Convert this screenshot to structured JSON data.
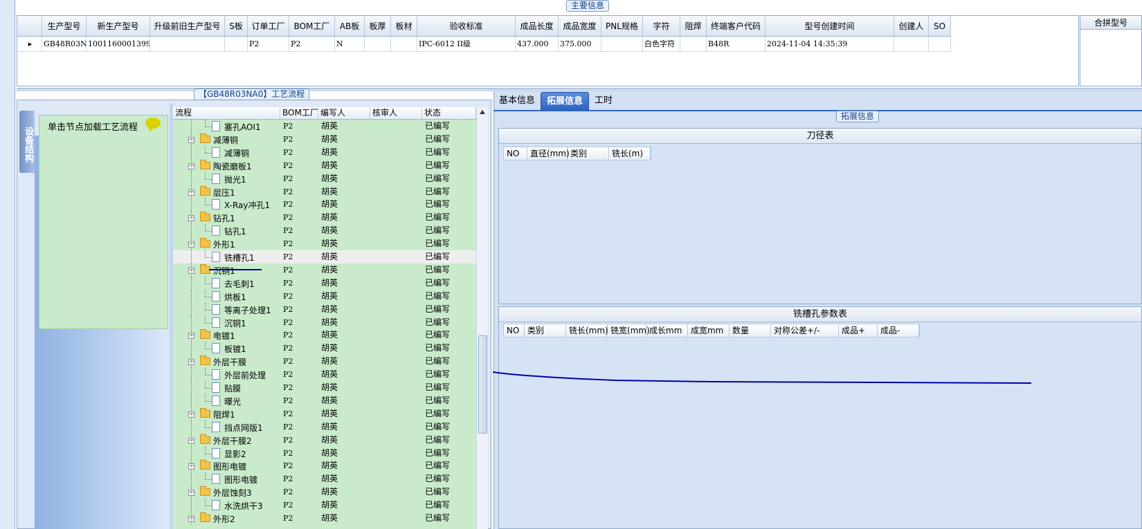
{
  "main_section_title": "主要信息",
  "top_grid": {
    "headers": [
      "生产型号",
      "新生产型号",
      "升级前旧生产型号",
      "S板",
      "订单工厂",
      "BOM工厂",
      "AB板",
      "板厚",
      "板材",
      "验收标准",
      "成品长度",
      "成品宽度",
      "PNL规格",
      "字符",
      "阻焊",
      "终端客户代码",
      "型号创建时间",
      "创建人",
      "SO"
    ],
    "row": [
      "GB48R03NA0",
      "10011600013991",
      "",
      "",
      "P2",
      "P2",
      "N",
      "",
      "",
      "IPC-6012 II级",
      "437.000",
      "375.000",
      "",
      "白色字符",
      "",
      "B48R",
      "2024-11-04 14:35:39",
      "",
      ""
    ],
    "row_marker": "▸"
  },
  "right_grid": {
    "header": "合拼型号"
  },
  "process": {
    "title": "【GB48R03NA0】工艺流程",
    "side_tab": "设备结构",
    "hint": "单击节点加载工艺流程",
    "headers": [
      "流程",
      "BOM工厂",
      "编写人",
      "核审人",
      "状态"
    ],
    "rows": [
      {
        "name": "塞孔AOI1",
        "level": 2,
        "bom": "P2",
        "author": "胡英",
        "status": "已编写"
      },
      {
        "name": "减薄铜",
        "level": 1,
        "bom": "P2",
        "author": "胡英",
        "status": "已编写"
      },
      {
        "name": "减薄铜",
        "level": 2,
        "bom": "P2",
        "author": "胡英",
        "status": "已编写"
      },
      {
        "name": "陶瓷磨板1",
        "level": 1,
        "bom": "P2",
        "author": "胡英",
        "status": "已编写"
      },
      {
        "name": "抛光1",
        "level": 2,
        "bom": "P2",
        "author": "胡英",
        "status": "已编写"
      },
      {
        "name": "层压1",
        "level": 1,
        "bom": "P2",
        "author": "胡英",
        "status": "已编写"
      },
      {
        "name": "X-Ray冲孔1",
        "level": 2,
        "bom": "P2",
        "author": "胡英",
        "status": "已编写"
      },
      {
        "name": "钻孔1",
        "level": 1,
        "bom": "P2",
        "author": "胡英",
        "status": "已编写"
      },
      {
        "name": "钻孔1",
        "level": 2,
        "bom": "P2",
        "author": "胡英",
        "status": "已编写"
      },
      {
        "name": "外形1",
        "level": 1,
        "bom": "P2",
        "author": "胡英",
        "status": "已编写"
      },
      {
        "name": "铣槽孔1",
        "level": 2,
        "bom": "P2",
        "author": "胡英",
        "status": "已编写",
        "selected": true
      },
      {
        "name": "沉铜1",
        "level": 1,
        "bom": "P2",
        "author": "胡英",
        "status": "已编写"
      },
      {
        "name": "去毛刺1",
        "level": 2,
        "bom": "P2",
        "author": "胡英",
        "status": "已编写"
      },
      {
        "name": "烘板1",
        "level": 2,
        "bom": "P2",
        "author": "胡英",
        "status": "已编写"
      },
      {
        "name": "等离子处理1",
        "level": 2,
        "bom": "P2",
        "author": "胡英",
        "status": "已编写"
      },
      {
        "name": "沉铜1",
        "level": 2,
        "bom": "P2",
        "author": "胡英",
        "status": "已编写"
      },
      {
        "name": "电镀1",
        "level": 1,
        "bom": "P2",
        "author": "胡英",
        "status": "已编写"
      },
      {
        "name": "板镀1",
        "level": 2,
        "bom": "P2",
        "author": "胡英",
        "status": "已编写"
      },
      {
        "name": "外层干膜",
        "level": 1,
        "bom": "P2",
        "author": "胡英",
        "status": "已编写"
      },
      {
        "name": "外层前处理",
        "level": 2,
        "bom": "P2",
        "author": "胡英",
        "status": "已编写"
      },
      {
        "name": "贴膜",
        "level": 2,
        "bom": "P2",
        "author": "胡英",
        "status": "已编写"
      },
      {
        "name": "曝光",
        "level": 2,
        "bom": "P2",
        "author": "胡英",
        "status": "已编写"
      },
      {
        "name": "阻焊1",
        "level": 1,
        "bom": "P2",
        "author": "胡英",
        "status": "已编写"
      },
      {
        "name": "挡点网版1",
        "level": 2,
        "bom": "P2",
        "author": "胡英",
        "status": "已编写"
      },
      {
        "name": "外层干膜2",
        "level": 1,
        "bom": "P2",
        "author": "胡英",
        "status": "已编写"
      },
      {
        "name": "显影2",
        "level": 2,
        "bom": "P2",
        "author": "胡英",
        "status": "已编写"
      },
      {
        "name": "图形电镀",
        "level": 1,
        "bom": "P2",
        "author": "胡英",
        "status": "已编写"
      },
      {
        "name": "图形电镀",
        "level": 2,
        "bom": "P2",
        "author": "胡英",
        "status": "已编写"
      },
      {
        "name": "外层蚀刻3",
        "level": 1,
        "bom": "P2",
        "author": "胡英",
        "status": "已编写"
      },
      {
        "name": "水洗烘干3",
        "level": 2,
        "bom": "P2",
        "author": "胡英",
        "status": "已编写"
      },
      {
        "name": "外形2",
        "level": 1,
        "bom": "P2",
        "author": "胡英",
        "status": "已编写"
      }
    ]
  },
  "right": {
    "tabs": [
      "基本信息",
      "拓展信息",
      "工时"
    ],
    "active_tab": 1,
    "section_title": "拓展信息",
    "cutter_table": {
      "title": "刀径表",
      "headers": [
        "NO",
        "直径(mm)",
        "类别",
        "铣长(m)"
      ]
    },
    "slot_table": {
      "title": "铣槽孔参数表",
      "headers": [
        "NO",
        "类别",
        "铣长(mm)",
        "铣宽(mm)",
        "成长mm",
        "成宽mm",
        "数量",
        "对称公差+/-",
        "成品+",
        "成品-"
      ]
    }
  },
  "colors": {
    "tree_bg": "#c9ebcb",
    "panel_bg": "#d6e3f5",
    "accent": "#2e64c2",
    "annotation_line": "#0000aa"
  }
}
